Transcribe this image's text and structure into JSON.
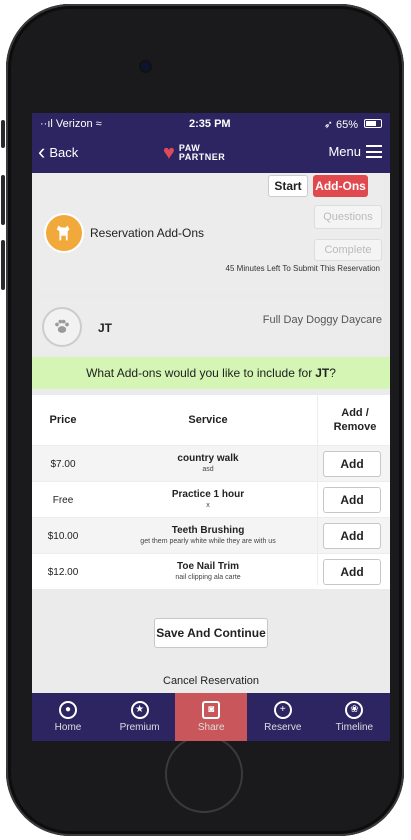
{
  "status": {
    "carrier": "Verizon",
    "time": "2:35 PM",
    "battery": "65%"
  },
  "nav": {
    "back_label": "Back",
    "logo_top": "PAW",
    "logo_bottom": "PARTNER",
    "menu_label": "Menu"
  },
  "reservation": {
    "title": "Reservation Add-Ons",
    "start_label": "Start",
    "addons_label": "Add-Ons",
    "questions_label": "Questions",
    "complete_label": "Complete",
    "time_left": "45 Minutes Left To Submit This Reservation"
  },
  "pet": {
    "name": "JT",
    "service": "Full Day Doggy Daycare"
  },
  "banner": {
    "prefix": "What Add-ons would you like to include for",
    "pet_name": "JT",
    "suffix": "?"
  },
  "table": {
    "headers": {
      "price": "Price",
      "service": "Service",
      "action": "Add / Remove"
    },
    "rows": [
      {
        "price": "$7.00",
        "name": "country walk",
        "desc": "asd",
        "action": "Add"
      },
      {
        "price": "Free",
        "name": "Practice 1 hour",
        "desc": "x",
        "action": "Add"
      },
      {
        "price": "$10.00",
        "name": "Teeth Brushing",
        "desc": "get them pearly white while they are with us",
        "action": "Add"
      },
      {
        "price": "$12.00",
        "name": "Toe Nail Trim",
        "desc": "nail clipping ala carte",
        "action": "Add"
      }
    ]
  },
  "actions": {
    "save_label": "Save And Continue",
    "cancel_label": "Cancel Reservation"
  },
  "tabs": [
    {
      "label": "Home",
      "icon": "user-icon",
      "active": false
    },
    {
      "label": "Premium",
      "icon": "star-icon",
      "active": false
    },
    {
      "label": "Share",
      "icon": "camera-icon",
      "active": true
    },
    {
      "label": "Reserve",
      "icon": "plus-icon",
      "active": false
    },
    {
      "label": "Timeline",
      "icon": "paw-icon",
      "active": false
    }
  ],
  "colors": {
    "brand": "#2d2562",
    "accent": "#e04a4f",
    "banner": "#d4f5b4",
    "share_tab": "#c9565a"
  }
}
